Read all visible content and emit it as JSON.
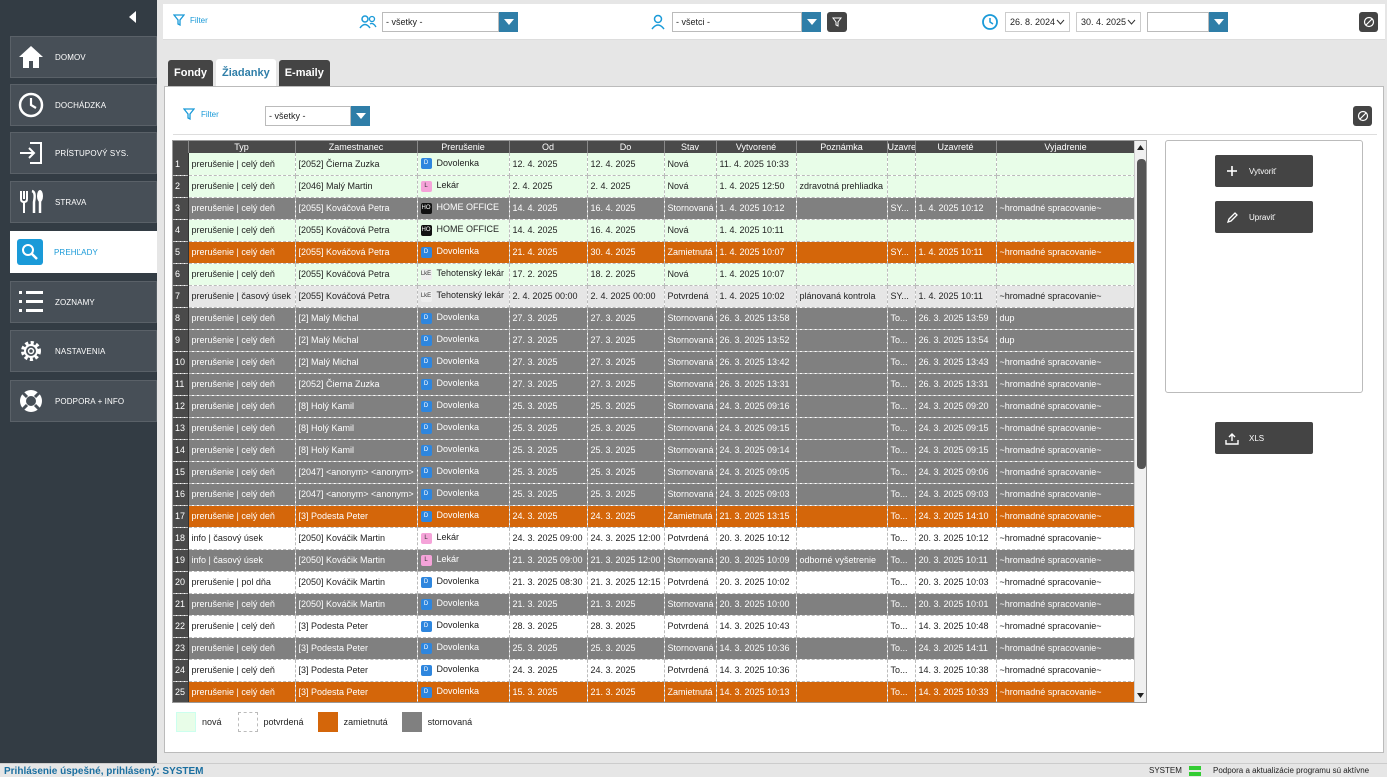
{
  "sidebar": {
    "items": [
      {
        "label": "DOMOV",
        "icon": "home-icon"
      },
      {
        "label": "DOCHÁDZKA",
        "icon": "clock-icon"
      },
      {
        "label": "PRÍSTUPOVÝ SYS.",
        "icon": "login-icon"
      },
      {
        "label": "STRAVA",
        "icon": "cutlery-icon"
      },
      {
        "label": "PREHĽADY",
        "icon": "search-icon"
      },
      {
        "label": "ZOZNAMY",
        "icon": "list-icon"
      },
      {
        "label": "NASTAVENIA",
        "icon": "gear-icon"
      },
      {
        "label": "PODPORA + INFO",
        "icon": "lifebuoy-icon"
      }
    ]
  },
  "topbar": {
    "filter_label": "Filter",
    "group_value": "- všetky -",
    "person_value": "- všetci -",
    "date_from": "26. 8. 2024",
    "date_to": "30. 4. 2025",
    "third_value": ""
  },
  "tabs": [
    {
      "label": "Fondy"
    },
    {
      "label": "Žiadanky"
    },
    {
      "label": "E-maily"
    }
  ],
  "panel": {
    "filter_label": "Filter",
    "filter_value": "- všetky -"
  },
  "table": {
    "columns": [
      "Typ",
      "Zamestnanec",
      "Prerušenie",
      "Od",
      "Do",
      "Stav",
      "Vytvorené",
      "Poznámka",
      "Uzavre",
      "Uzavreté",
      "Vyjadrenie"
    ],
    "rows": [
      {
        "n": "1",
        "typ": "prerušenie | celý deň",
        "zam": "[2052] Čierna Zuzka",
        "pi": "D",
        "pc": "#2e86de",
        "pr": "Dovolenka",
        "od": "12. 4. 2025",
        "do": "12. 4. 2025",
        "stav": "Nová",
        "vyt": "11. 4. 2025  10:33",
        "poz": "",
        "uzv": "",
        "uzt": "",
        "vyj": "",
        "cls": "r-nova"
      },
      {
        "n": "2",
        "typ": "prerušenie | celý deň",
        "zam": "[2046] Malý Martin",
        "pi": "L",
        "pc": "#f5a3d9",
        "pr": "Lekár",
        "od": "2. 4. 2025",
        "do": "2. 4. 2025",
        "stav": "Nová",
        "vyt": "1. 4. 2025  12:50",
        "poz": "zdravotná prehliadka",
        "uzv": "",
        "uzt": "",
        "vyj": "",
        "cls": "r-nova"
      },
      {
        "n": "3",
        "typ": "prerušenie | celý deň",
        "zam": "[2055] Kováčová Petra",
        "pi": "HO",
        "pc": "#111",
        "pr": "HOME OFFICE",
        "od": "14. 4. 2025",
        "do": "16. 4. 2025",
        "stav": "Stornovaná",
        "vyt": "1. 4. 2025  10:12",
        "poz": "",
        "uzv": "SY...",
        "uzt": "1. 4. 2025  10:12",
        "vyj": "~hromadné spracovanie~",
        "cls": "r-stor"
      },
      {
        "n": "4",
        "typ": "prerušenie | celý deň",
        "zam": "[2055] Kováčová Petra",
        "pi": "HO",
        "pc": "#111",
        "pr": "HOME OFFICE",
        "od": "14. 4. 2025",
        "do": "16. 4. 2025",
        "stav": "Nová",
        "vyt": "1. 4. 2025  10:11",
        "poz": "",
        "uzv": "",
        "uzt": "",
        "vyj": "",
        "cls": "r-nova"
      },
      {
        "n": "5",
        "typ": "prerušenie | celý deň",
        "zam": "[2055] Kováčová Petra",
        "pi": "D",
        "pc": "#2e86de",
        "pr": "Dovolenka",
        "od": "21. 4. 2025",
        "do": "30. 4. 2025",
        "stav": "Zamietnutá",
        "vyt": "1. 4. 2025  10:07",
        "poz": "",
        "uzv": "SY...",
        "uzt": "1. 4. 2025  10:11",
        "vyj": "~hromadné spracovanie~",
        "cls": "r-zam"
      },
      {
        "n": "6",
        "typ": "prerušenie | celý deň",
        "zam": "[2055] Kováčová Petra",
        "pi": "LkE",
        "pc": "#eee",
        "pr": "Tehotenský lekár",
        "od": "17. 2. 2025",
        "do": "18. 2. 2025",
        "stav": "Nová",
        "vyt": "1. 4. 2025  10:07",
        "poz": "",
        "uzv": "",
        "uzt": "",
        "vyj": "",
        "cls": "r-nova"
      },
      {
        "n": "7",
        "typ": "prerušenie | časový úsek",
        "zam": "[2055] Kováčová Petra",
        "pi": "LkE",
        "pc": "#eee",
        "pr": "Tehotenský lekár",
        "od": "2. 4. 2025 00:00",
        "do": "2. 4. 2025 00:00",
        "stav": "Potvrdená",
        "vyt": "1. 4. 2025  10:02",
        "poz": "plánovaná kontrola",
        "uzv": "SY...",
        "uzt": "1. 4. 2025  10:11",
        "vyj": "~hromadné spracovanie~",
        "cls": "r-potv2"
      },
      {
        "n": "8",
        "typ": "prerušenie | celý deň",
        "zam": "[2] Malý Michal",
        "pi": "D",
        "pc": "#2e86de",
        "pr": "Dovolenka",
        "od": "27. 3. 2025",
        "do": "27. 3. 2025",
        "stav": "Stornovaná",
        "vyt": "26. 3. 2025  13:58",
        "poz": "",
        "uzv": "To...",
        "uzt": "26. 3. 2025  13:59",
        "vyj": "dup",
        "cls": "r-stor"
      },
      {
        "n": "9",
        "typ": "prerušenie | celý deň",
        "zam": "[2] Malý Michal",
        "pi": "D",
        "pc": "#2e86de",
        "pr": "Dovolenka",
        "od": "27. 3. 2025",
        "do": "27. 3. 2025",
        "stav": "Stornovaná",
        "vyt": "26. 3. 2025  13:52",
        "poz": "",
        "uzv": "To...",
        "uzt": "26. 3. 2025  13:54",
        "vyj": "dup",
        "cls": "r-stor"
      },
      {
        "n": "10",
        "typ": "prerušenie | celý deň",
        "zam": "[2] Malý Michal",
        "pi": "D",
        "pc": "#2e86de",
        "pr": "Dovolenka",
        "od": "27. 3. 2025",
        "do": "27. 3. 2025",
        "stav": "Stornovaná",
        "vyt": "26. 3. 2025  13:42",
        "poz": "",
        "uzv": "To...",
        "uzt": "26. 3. 2025  13:43",
        "vyj": "~hromadné spracovanie~",
        "cls": "r-stor"
      },
      {
        "n": "11",
        "typ": "prerušenie | celý deň",
        "zam": "[2052] Čierna Zuzka",
        "pi": "D",
        "pc": "#2e86de",
        "pr": "Dovolenka",
        "od": "27. 3. 2025",
        "do": "27. 3. 2025",
        "stav": "Stornovaná",
        "vyt": "26. 3. 2025  13:31",
        "poz": "",
        "uzv": "To...",
        "uzt": "26. 3. 2025  13:31",
        "vyj": "~hromadné spracovanie~",
        "cls": "r-stor"
      },
      {
        "n": "12",
        "typ": "prerušenie | celý deň",
        "zam": "[8] Holý Kamil",
        "pi": "D",
        "pc": "#2e86de",
        "pr": "Dovolenka",
        "od": "25. 3. 2025",
        "do": "25. 3. 2025",
        "stav": "Stornovaná",
        "vyt": "24. 3. 2025  09:16",
        "poz": "",
        "uzv": "To...",
        "uzt": "24. 3. 2025  09:20",
        "vyj": "~hromadné spracovanie~",
        "cls": "r-stor"
      },
      {
        "n": "13",
        "typ": "prerušenie | celý deň",
        "zam": "[8] Holý Kamil",
        "pi": "D",
        "pc": "#2e86de",
        "pr": "Dovolenka",
        "od": "25. 3. 2025",
        "do": "25. 3. 2025",
        "stav": "Stornovaná",
        "vyt": "24. 3. 2025  09:15",
        "poz": "",
        "uzv": "To...",
        "uzt": "24. 3. 2025  09:15",
        "vyj": "~hromadné spracovanie~",
        "cls": "r-stor"
      },
      {
        "n": "14",
        "typ": "prerušenie | celý deň",
        "zam": "[8] Holý Kamil",
        "pi": "D",
        "pc": "#2e86de",
        "pr": "Dovolenka",
        "od": "25. 3. 2025",
        "do": "25. 3. 2025",
        "stav": "Stornovaná",
        "vyt": "24. 3. 2025  09:14",
        "poz": "",
        "uzv": "To...",
        "uzt": "24. 3. 2025  09:15",
        "vyj": "~hromadné spracovanie~",
        "cls": "r-stor"
      },
      {
        "n": "15",
        "typ": "prerušenie | celý deň",
        "zam": "[2047] <anonym> <anonym>",
        "pi": "D",
        "pc": "#2e86de",
        "pr": "Dovolenka",
        "od": "25. 3. 2025",
        "do": "25. 3. 2025",
        "stav": "Stornovaná",
        "vyt": "24. 3. 2025  09:05",
        "poz": "",
        "uzv": "To...",
        "uzt": "24. 3. 2025  09:06",
        "vyj": "~hromadné spracovanie~",
        "cls": "r-stor"
      },
      {
        "n": "16",
        "typ": "prerušenie | celý deň",
        "zam": "[2047] <anonym> <anonym>",
        "pi": "D",
        "pc": "#2e86de",
        "pr": "Dovolenka",
        "od": "25. 3. 2025",
        "do": "25. 3. 2025",
        "stav": "Stornovaná",
        "vyt": "24. 3. 2025  09:03",
        "poz": "",
        "uzv": "To...",
        "uzt": "24. 3. 2025  09:03",
        "vyj": "~hromadné spracovanie~",
        "cls": "r-stor"
      },
      {
        "n": "17",
        "typ": "prerušenie | celý deň",
        "zam": "[3] Podesta Peter",
        "pi": "D",
        "pc": "#2e86de",
        "pr": "Dovolenka",
        "od": "24. 3. 2025",
        "do": "24. 3. 2025",
        "stav": "Zamietnutá",
        "vyt": "21. 3. 2025  13:15",
        "poz": "",
        "uzv": "To...",
        "uzt": "24. 3. 2025  14:10",
        "vyj": "~hromadné spracovanie~",
        "cls": "r-zam"
      },
      {
        "n": "18",
        "typ": "info | časový úsek",
        "zam": "[2050] Kováčik Martin",
        "pi": "L",
        "pc": "#f5a3d9",
        "pr": "Lekár",
        "od": "24. 3. 2025 09:00",
        "do": "24. 3. 2025 12:00",
        "stav": "Potvrdená",
        "vyt": "20. 3. 2025  10:12",
        "poz": "",
        "uzv": "To...",
        "uzt": "20. 3. 2025  10:12",
        "vyj": "~hromadné spracovanie~",
        "cls": "r-potv"
      },
      {
        "n": "19",
        "typ": "info | časový úsek",
        "zam": "[2050] Kováčik Martin",
        "pi": "L",
        "pc": "#f5a3d9",
        "pr": "Lekár",
        "od": "21. 3. 2025 09:00",
        "do": "21. 3. 2025 12:00",
        "stav": "Stornovaná",
        "vyt": "20. 3. 2025  10:09",
        "poz": "odborné vyšetrenie",
        "uzv": "To...",
        "uzt": "20. 3. 2025  10:11",
        "vyj": "~hromadné spracovanie~",
        "cls": "r-stor"
      },
      {
        "n": "20",
        "typ": "prerušenie | pol dňa",
        "zam": "[2050] Kováčik Martin",
        "pi": "D",
        "pc": "#2e86de",
        "pr": "Dovolenka",
        "od": "21. 3. 2025 08:30",
        "do": "21. 3. 2025 12:15",
        "stav": "Potvrdená",
        "vyt": "20. 3. 2025  10:02",
        "poz": "",
        "uzv": "To...",
        "uzt": "20. 3. 2025  10:03",
        "vyj": "~hromadné spracovanie~",
        "cls": "r-potv"
      },
      {
        "n": "21",
        "typ": "prerušenie | celý deň",
        "zam": "[2050] Kováčik Martin",
        "pi": "D",
        "pc": "#2e86de",
        "pr": "Dovolenka",
        "od": "21. 3. 2025",
        "do": "21. 3. 2025",
        "stav": "Stornovaná",
        "vyt": "20. 3. 2025  10:00",
        "poz": "",
        "uzv": "To...",
        "uzt": "20. 3. 2025  10:01",
        "vyj": "~hromadné spracovanie~",
        "cls": "r-stor"
      },
      {
        "n": "22",
        "typ": "prerušenie | celý deň",
        "zam": "[3] Podesta Peter",
        "pi": "D",
        "pc": "#2e86de",
        "pr": "Dovolenka",
        "od": "28. 3. 2025",
        "do": "28. 3. 2025",
        "stav": "Potvrdená",
        "vyt": "14. 3. 2025  10:43",
        "poz": "",
        "uzv": "To...",
        "uzt": "14. 3. 2025  10:48",
        "vyj": "~hromadné spracovanie~",
        "cls": "r-potv"
      },
      {
        "n": "23",
        "typ": "prerušenie | celý deň",
        "zam": "[3] Podesta Peter",
        "pi": "D",
        "pc": "#2e86de",
        "pr": "Dovolenka",
        "od": "25. 3. 2025",
        "do": "25. 3. 2025",
        "stav": "Stornovaná",
        "vyt": "14. 3. 2025  10:36",
        "poz": "",
        "uzv": "To...",
        "uzt": "24. 3. 2025  14:11",
        "vyj": "~hromadné spracovanie~",
        "cls": "r-stor"
      },
      {
        "n": "24",
        "typ": "prerušenie | celý deň",
        "zam": "[3] Podesta Peter",
        "pi": "D",
        "pc": "#2e86de",
        "pr": "Dovolenka",
        "od": "24. 3. 2025",
        "do": "24. 3. 2025",
        "stav": "Potvrdená",
        "vyt": "14. 3. 2025  10:36",
        "poz": "",
        "uzv": "To...",
        "uzt": "14. 3. 2025  10:38",
        "vyj": "~hromadné spracovanie~",
        "cls": "r-potv"
      },
      {
        "n": "25",
        "typ": "prerušenie | celý deň",
        "zam": "[3] Podesta Peter",
        "pi": "D",
        "pc": "#2e86de",
        "pr": "Dovolenka",
        "od": "15. 3. 2025",
        "do": "21. 3. 2025",
        "stav": "Zamietnutá",
        "vyt": "14. 3. 2025  10:13",
        "poz": "",
        "uzv": "To...",
        "uzt": "14. 3. 2025  10:33",
        "vyj": "~hromadné spracovanie~",
        "cls": "r-zam"
      }
    ]
  },
  "actions": {
    "create_label": "Vytvoriť",
    "edit_label": "Upraviť",
    "export_label": "XLS"
  },
  "legend": [
    {
      "label": "nová",
      "color": "#e8fde8"
    },
    {
      "label": "potvrdená",
      "color": "#ffffff"
    },
    {
      "label": "zamietnutá",
      "color": "#d4660a"
    },
    {
      "label": "stornovaná",
      "color": "#808080"
    }
  ],
  "status": {
    "message": "Prihlásenie úspešné, prihlásený: SYSTEM",
    "user": "SYSTEM",
    "support": "Podpora a aktualizácie programu sú aktívne"
  }
}
